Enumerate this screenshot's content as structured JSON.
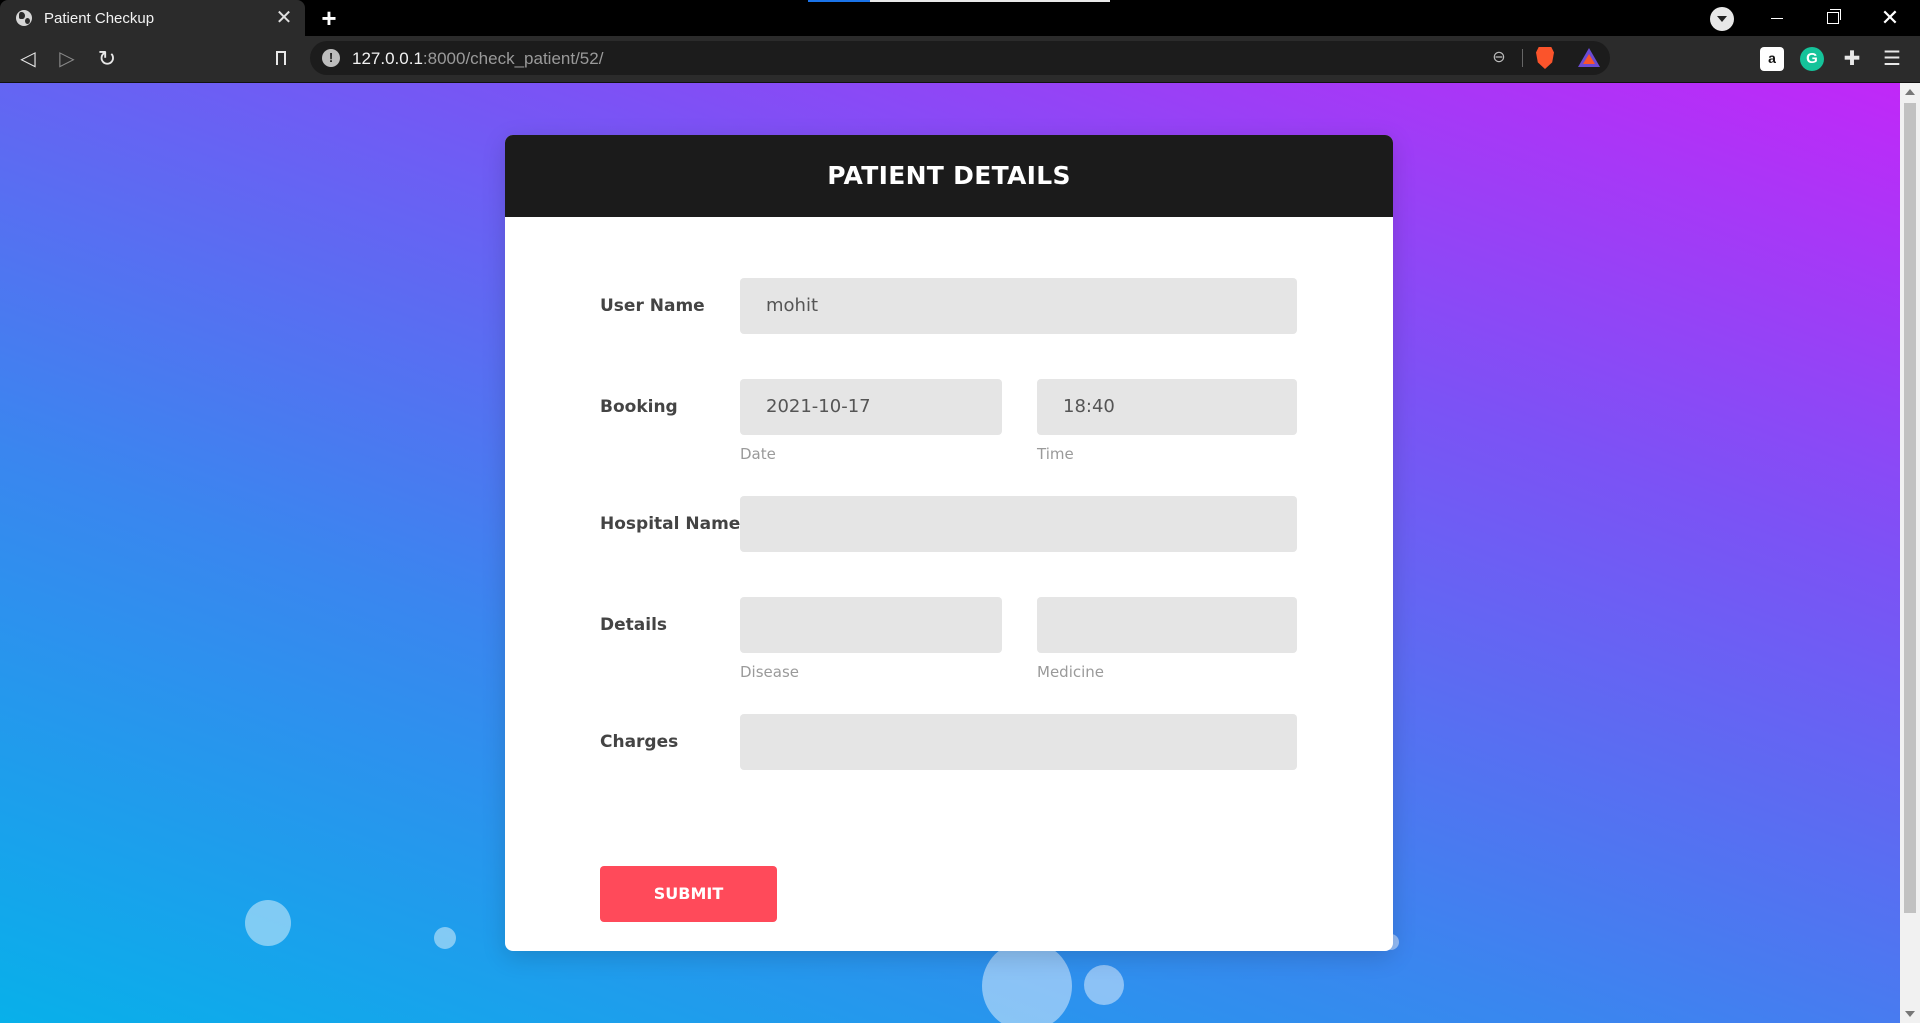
{
  "browser": {
    "tab_title": "Patient Checkup",
    "tab_close": "✕",
    "new_tab": "+",
    "url_host": "127.0.0.1",
    "url_rest": ":8000/check_patient/52/",
    "icons": [
      "globe-icon",
      "back-icon",
      "forward-icon",
      "reload-icon",
      "bookmark-icon",
      "info-icon",
      "zoom-out-icon",
      "brave-shield-icon",
      "brave-rewards-icon",
      "amazon-extension-icon",
      "grammarly-icon",
      "extensions-puzzle-icon",
      "menu-icon"
    ]
  },
  "form": {
    "title": "PATIENT DETAILS",
    "username_label": "User Name",
    "username_value": "mohit",
    "booking_label": "Booking",
    "date_value": "2021-10-17",
    "date_caption": "Date",
    "time_value": "18:40",
    "time_caption": "Time",
    "hospital_label": "Hospital Name",
    "hospital_value": "",
    "details_label": "Details",
    "disease_value": "",
    "disease_caption": "Disease",
    "medicine_value": "",
    "medicine_caption": "Medicine",
    "charges_label": "Charges",
    "charges_value": "",
    "submit_label": "SUBMIT"
  },
  "colors": {
    "header_bg": "#1b1b1b",
    "submit_bg": "#ff4a5a",
    "field_bg": "#e5e5e5",
    "gradient_start": "#08b0ea",
    "gradient_end": "#c227f8"
  }
}
